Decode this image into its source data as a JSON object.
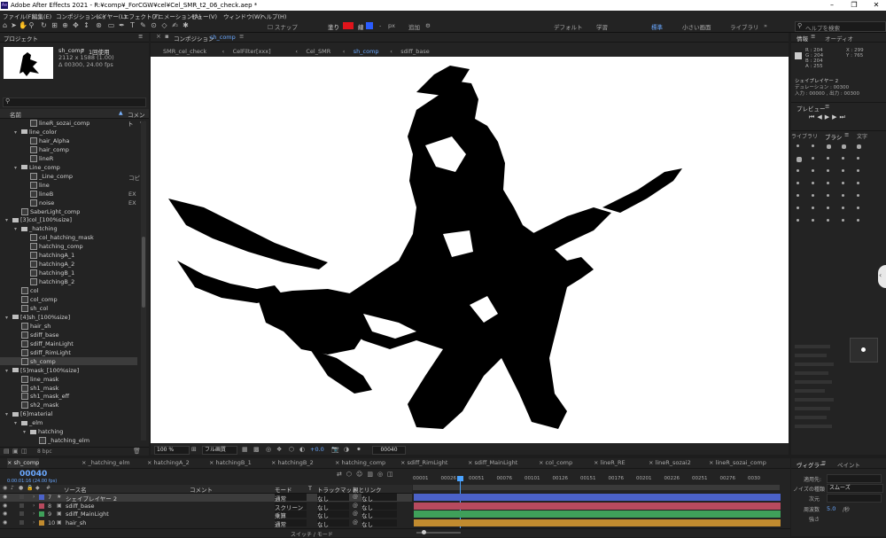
{
  "app": {
    "title": "Adobe After Effects 2021 - R:¥comp¥_ForCGW¥cel¥Cel_SMR_t2_06_check.aep *",
    "logo": "Ae"
  },
  "menu": [
    "ファイル(F)",
    "編集(E)",
    "コンポジション(C)",
    "レイヤー(L)",
    "エフェクト(T)",
    "アニメーション(A)",
    "ビュー(V)",
    "ウィンドウ(W)",
    "ヘルプ(H)"
  ],
  "toolbar": {
    "snap": "スナップ",
    "fill_label": "塗り",
    "stroke_label": "線",
    "stroke_width": "-",
    "px": "px",
    "add": "追加",
    "ws_default": "デフォルト",
    "ws_learn": "学習",
    "ws_standard": "標準",
    "ws_small": "小さい画面",
    "ws_library": "ライブラリ",
    "help_placeholder": "ヘルプを検索"
  },
  "project": {
    "tab": "プロジェクト",
    "item_name": "sh_comp",
    "item_used": "1回使用",
    "item_size": "2112 x 1588 (1.00)",
    "item_dur": "Δ 00300, 24.00 fps",
    "col_name": "名前",
    "col_comment": "コメント",
    "bpc": "8 bpc",
    "items": [
      {
        "name": "lineR_sozai_comp",
        "kind": "comp",
        "indent": 2,
        "comment": ""
      },
      {
        "name": "line_color",
        "kind": "folder",
        "indent": 1,
        "comment": ""
      },
      {
        "name": "hair_Alpha",
        "kind": "comp",
        "indent": 2,
        "comment": ""
      },
      {
        "name": "hair_comp",
        "kind": "comp",
        "indent": 2,
        "comment": ""
      },
      {
        "name": "lineR",
        "kind": "comp",
        "indent": 2,
        "comment": ""
      },
      {
        "name": "Line_comp",
        "kind": "folder",
        "indent": 1,
        "comment": ""
      },
      {
        "name": "_Line_comp",
        "kind": "comp",
        "indent": 2,
        "comment": "コピ"
      },
      {
        "name": "line",
        "kind": "comp",
        "indent": 2,
        "comment": ""
      },
      {
        "name": "lineB",
        "kind": "comp",
        "indent": 2,
        "comment": "EX"
      },
      {
        "name": "noise",
        "kind": "comp",
        "indent": 2,
        "comment": "EX"
      },
      {
        "name": "SaberLight_comp",
        "kind": "comp",
        "indent": 1,
        "comment": ""
      },
      {
        "name": "[3]col_[100%size]",
        "kind": "folder",
        "indent": 0,
        "comment": ""
      },
      {
        "name": "_hatching",
        "kind": "folder",
        "indent": 1,
        "comment": ""
      },
      {
        "name": "col_hatching_mask",
        "kind": "comp",
        "indent": 2,
        "comment": ""
      },
      {
        "name": "hatching_comp",
        "kind": "comp",
        "indent": 2,
        "comment": ""
      },
      {
        "name": "hatchingA_1",
        "kind": "comp",
        "indent": 2,
        "comment": ""
      },
      {
        "name": "hatchingA_2",
        "kind": "comp",
        "indent": 2,
        "comment": ""
      },
      {
        "name": "hatchingB_1",
        "kind": "comp",
        "indent": 2,
        "comment": ""
      },
      {
        "name": "hatchingB_2",
        "kind": "comp",
        "indent": 2,
        "comment": ""
      },
      {
        "name": "col",
        "kind": "comp",
        "indent": 1,
        "comment": ""
      },
      {
        "name": "col_comp",
        "kind": "comp",
        "indent": 1,
        "comment": ""
      },
      {
        "name": "sh_col",
        "kind": "comp",
        "indent": 1,
        "comment": ""
      },
      {
        "name": "[4]sh_[100%size]",
        "kind": "folder",
        "indent": 0,
        "comment": ""
      },
      {
        "name": "hair_sh",
        "kind": "comp",
        "indent": 1,
        "comment": ""
      },
      {
        "name": "sdiff_base",
        "kind": "comp",
        "indent": 1,
        "comment": ""
      },
      {
        "name": "sdiff_MainLight",
        "kind": "comp",
        "indent": 1,
        "comment": ""
      },
      {
        "name": "sdiff_RimLight",
        "kind": "comp",
        "indent": 1,
        "comment": ""
      },
      {
        "name": "sh_comp",
        "kind": "comp",
        "indent": 1,
        "comment": "",
        "selected": true
      },
      {
        "name": "[5]mask_[100%size]",
        "kind": "folder",
        "indent": 0,
        "comment": ""
      },
      {
        "name": "line_mask",
        "kind": "comp",
        "indent": 1,
        "comment": ""
      },
      {
        "name": "sh1_mask",
        "kind": "comp",
        "indent": 1,
        "comment": ""
      },
      {
        "name": "sh1_mask_eff",
        "kind": "comp",
        "indent": 1,
        "comment": ""
      },
      {
        "name": "sh2_mask",
        "kind": "comp",
        "indent": 1,
        "comment": ""
      },
      {
        "name": "[6]material",
        "kind": "folder",
        "indent": 0,
        "comment": ""
      },
      {
        "name": "_elm",
        "kind": "folder",
        "indent": 1,
        "comment": ""
      },
      {
        "name": "hatching",
        "kind": "folder",
        "indent": 2,
        "comment": ""
      },
      {
        "name": "_hatching_elm",
        "kind": "comp",
        "indent": 3,
        "comment": ""
      }
    ]
  },
  "comp": {
    "panel_label": "コンポジション",
    "panel_name": "sh_comp",
    "breadcrumbs": [
      "SMR_cel_check",
      "CelFilter[xxx]",
      "Cel_SMR",
      "sh_comp",
      "sdiff_base"
    ],
    "active_crumb": 3,
    "zoom": "100 %",
    "quality": "フル画質",
    "exposure": "+0.0",
    "timecode": "00040"
  },
  "info": {
    "tab1": "情報",
    "tab2": "オーディオ",
    "r": "R : 204",
    "g": "G : 204",
    "b": "B : 204",
    "a": "A : 255",
    "x": "X : 299",
    "y": "Y : 765",
    "layer": "シェイプレイヤー 2",
    "duration": "デュレーション : 00300",
    "inout": "入力 : 00000 , 出力 : 00300"
  },
  "preview": {
    "tab": "プレビュー"
  },
  "brush": {
    "tab_library": "ライブラリ",
    "tab_brush": "ブラシ",
    "tab_char": "文字"
  },
  "viewer": {
    "tab": "ヴィグラー",
    "tab2": "ペイント",
    "apply_label": "適用先:",
    "blend_label": "ノイズの種類",
    "blend_value": "スムーズ",
    "dims_label": "次元",
    "scale_label": "周波数",
    "scale_value": "5.0",
    "scale_unit": "/秒",
    "strength_label": "強さ"
  },
  "timeline": {
    "tabs": [
      "sh_comp",
      "_hatching_elm",
      "hatchingA_2",
      "hatchingB_1",
      "hatchingB_2",
      "hatching_comp",
      "sdiff_RimLight",
      "sdiff_MainLight",
      "col_comp",
      "lineR_RE",
      "lineR_sozai2",
      "lineR_sozai_comp"
    ],
    "timecode": "00040",
    "tc_sub": "0:00:01:16 (24.00 fps)",
    "col_source": "ソース名",
    "col_comment": "コメント",
    "col_mode": "モード",
    "col_t": "T",
    "col_trackmatte": "トラックマット",
    "col_parent": "親とリンク",
    "toggle": "スイッチ / モード",
    "ruler": [
      "00001",
      "00026",
      "00051",
      "00076",
      "00101",
      "00126",
      "00151",
      "00176",
      "00201",
      "00226",
      "00251",
      "00276",
      "0030"
    ],
    "layers": [
      {
        "num": "7",
        "name": "シェイプレイヤー 2",
        "mode": "通常",
        "track": "なし",
        "parent": "なし",
        "color": "#4b62c9",
        "selected": true
      },
      {
        "num": "8",
        "name": "sdiff_base",
        "mode": "スクリーン",
        "track": "なし",
        "parent": "なし",
        "color": "#b74a5e"
      },
      {
        "num": "9",
        "name": "sdiff_MainLight",
        "mode": "乗算",
        "track": "なし",
        "parent": "なし",
        "color": "#3fa05a"
      },
      {
        "num": "10",
        "name": "hair_sh",
        "mode": "通常",
        "track": "なし",
        "parent": "なし",
        "color": "#c18b2f"
      }
    ]
  }
}
